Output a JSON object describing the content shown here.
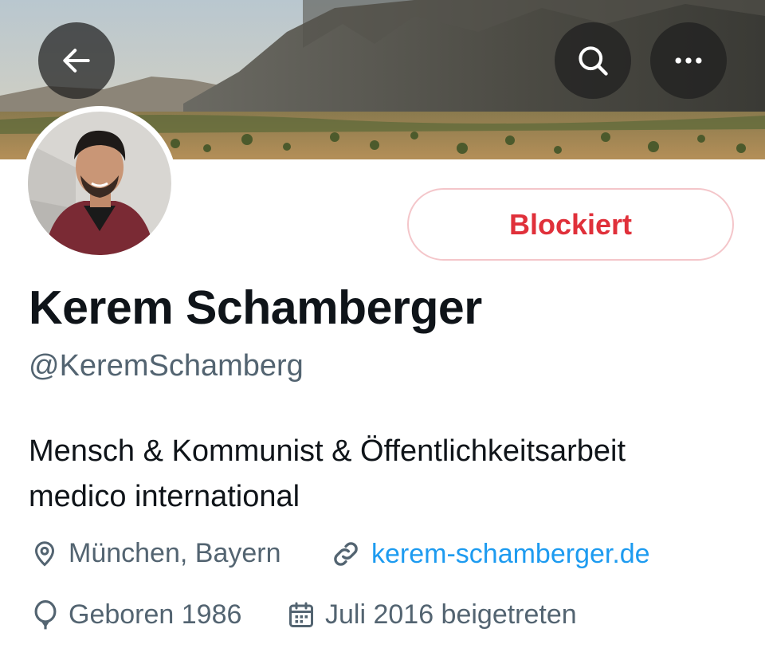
{
  "header": {
    "back_icon": "arrow-left-icon",
    "search_icon": "search-icon",
    "more_icon": "more-horizontal-icon",
    "banner_description": "mountain valley landscape banner"
  },
  "profile": {
    "block_button_label": "Blockiert",
    "display_name": "Kerem Schamberger",
    "handle": "@KeremSchamberg",
    "bio_lines": [
      "Mensch & Kommunist & Öffentlichkeitsarbeit",
      "medico international"
    ],
    "location": "München, Bayern",
    "website": "kerem-schamberger.de",
    "birthday": "Geboren 1986",
    "joined": "Juli 2016 beigetreten"
  },
  "colors": {
    "blocked_red": "#e0303a",
    "blocked_border": "#f4c6ca",
    "link_blue": "#1d9bf0",
    "secondary_text": "#536471",
    "primary_text": "#0f1419"
  }
}
